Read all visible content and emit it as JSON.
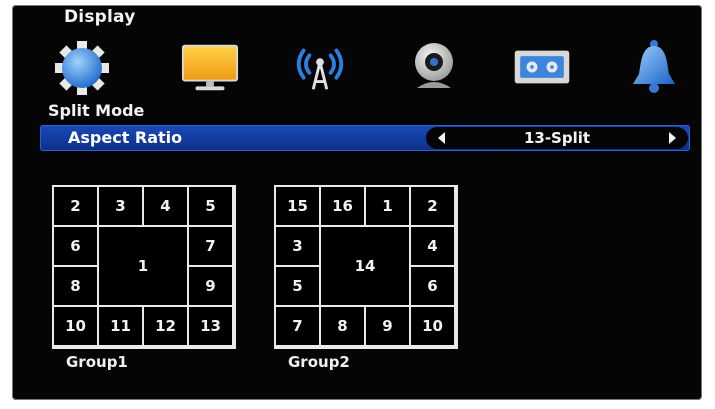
{
  "header": {
    "title": "Display",
    "submode": "Split Mode"
  },
  "icons": [
    {
      "name": "gear-icon"
    },
    {
      "name": "monitor-icon"
    },
    {
      "name": "wireless-icon"
    },
    {
      "name": "webcam-icon"
    },
    {
      "name": "record-icon"
    },
    {
      "name": "bell-icon"
    }
  ],
  "setting": {
    "label": "Aspect Ratio",
    "value": "13-Split"
  },
  "groups": [
    {
      "label": "Group1",
      "cells": [
        {
          "t": "2",
          "c": 0,
          "r": 0,
          "cs": 1,
          "rs": 1
        },
        {
          "t": "3",
          "c": 1,
          "r": 0,
          "cs": 1,
          "rs": 1
        },
        {
          "t": "4",
          "c": 2,
          "r": 0,
          "cs": 1,
          "rs": 1
        },
        {
          "t": "5",
          "c": 3,
          "r": 0,
          "cs": 1,
          "rs": 1
        },
        {
          "t": "6",
          "c": 0,
          "r": 1,
          "cs": 1,
          "rs": 1
        },
        {
          "t": "1",
          "c": 1,
          "r": 1,
          "cs": 2,
          "rs": 2
        },
        {
          "t": "7",
          "c": 3,
          "r": 1,
          "cs": 1,
          "rs": 1
        },
        {
          "t": "8",
          "c": 0,
          "r": 2,
          "cs": 1,
          "rs": 1
        },
        {
          "t": "9",
          "c": 3,
          "r": 2,
          "cs": 1,
          "rs": 1
        },
        {
          "t": "10",
          "c": 0,
          "r": 3,
          "cs": 1,
          "rs": 1
        },
        {
          "t": "11",
          "c": 1,
          "r": 3,
          "cs": 1,
          "rs": 1
        },
        {
          "t": "12",
          "c": 2,
          "r": 3,
          "cs": 1,
          "rs": 1
        },
        {
          "t": "13",
          "c": 3,
          "r": 3,
          "cs": 1,
          "rs": 1
        }
      ]
    },
    {
      "label": "Group2",
      "cells": [
        {
          "t": "15",
          "c": 0,
          "r": 0,
          "cs": 1,
          "rs": 1
        },
        {
          "t": "16",
          "c": 1,
          "r": 0,
          "cs": 1,
          "rs": 1
        },
        {
          "t": "1",
          "c": 2,
          "r": 0,
          "cs": 1,
          "rs": 1
        },
        {
          "t": "2",
          "c": 3,
          "r": 0,
          "cs": 1,
          "rs": 1
        },
        {
          "t": "3",
          "c": 0,
          "r": 1,
          "cs": 1,
          "rs": 1
        },
        {
          "t": "14",
          "c": 1,
          "r": 1,
          "cs": 2,
          "rs": 2
        },
        {
          "t": "4",
          "c": 3,
          "r": 1,
          "cs": 1,
          "rs": 1
        },
        {
          "t": "5",
          "c": 0,
          "r": 2,
          "cs": 1,
          "rs": 1
        },
        {
          "t": "6",
          "c": 3,
          "r": 2,
          "cs": 1,
          "rs": 1
        },
        {
          "t": "7",
          "c": 0,
          "r": 3,
          "cs": 1,
          "rs": 1
        },
        {
          "t": "8",
          "c": 1,
          "r": 3,
          "cs": 1,
          "rs": 1
        },
        {
          "t": "9",
          "c": 2,
          "r": 3,
          "cs": 1,
          "rs": 1
        },
        {
          "t": "10",
          "c": 3,
          "r": 3,
          "cs": 1,
          "rs": 1
        }
      ]
    }
  ],
  "colors": {
    "selected_bar": "#1a4ab8",
    "background": "#050505",
    "text": "#f2f2f2"
  }
}
